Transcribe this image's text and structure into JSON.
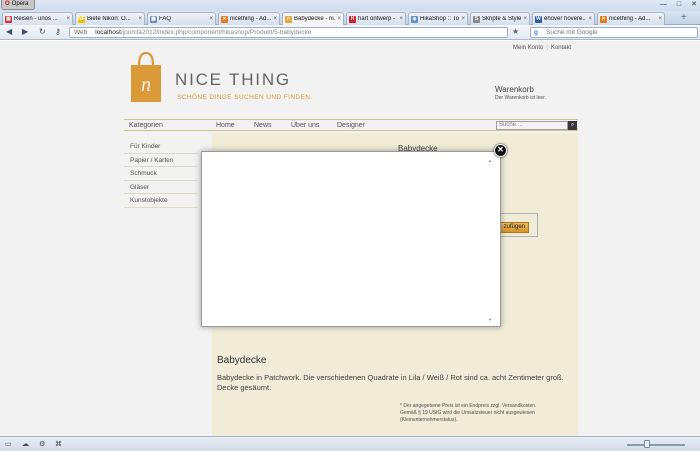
{
  "browser": {
    "app_name": "Opera",
    "window_controls": [
      "—",
      "□",
      "✕"
    ],
    "tabs": [
      {
        "label": "Reisen - unos ...",
        "fav_color": "#cc3333",
        "fav_glyph": "▣"
      },
      {
        "label": "Biete Nikon: O...",
        "fav_color": "#f2c200",
        "fav_glyph": "NF"
      },
      {
        "label": "FAQ",
        "fav_color": "#6b8ab5",
        "fav_glyph": "▦"
      },
      {
        "label": "nicething - Ad...",
        "fav_color": "#e07b1e",
        "fav_glyph": "✕"
      },
      {
        "label": "Babydecke - ni...",
        "fav_color": "#e6a33a",
        "fav_glyph": "n"
      },
      {
        "label": "hart ontwerp - ...",
        "fav_color": "#d0202e",
        "fav_glyph": "H"
      },
      {
        "label": "HikaShop :: To...",
        "fav_color": "#5b8fc4",
        "fav_glyph": "◈"
      },
      {
        "label": "Skripte & Style...",
        "fav_color": "#888888",
        "fav_glyph": "S"
      },
      {
        "label": "ehover hovere...",
        "fav_color": "#2f5aa8",
        "fav_glyph": "W"
      },
      {
        "label": "nicething - Ad...",
        "fav_color": "#e07b1e",
        "fav_glyph": "✕"
      }
    ],
    "tab_close": "×",
    "tab_add": "+",
    "nav": {
      "back": "◀",
      "forward": "▶",
      "reload": "↻",
      "key": "⚷"
    },
    "address": {
      "prefix": "Web",
      "host": "localhost",
      "path": "/joomla2012/index.php/component/hikashop/Produkt/5-babydecke"
    },
    "star": "★",
    "search_placeholder": "Suche mit Google",
    "search_engine_glyph": "g"
  },
  "site": {
    "top_links": [
      "Mein Konto",
      "Kontakt"
    ],
    "logo_title": "NICE THING",
    "logo_subtitle": "SCHÖNE DINGE SUCHEN UND FINDEN.",
    "logo_letter": "n",
    "cart": {
      "title": "Warenkorb",
      "text": "Der Warenkorb ist leer."
    },
    "menu": [
      "Kategorien",
      "Home",
      "News",
      "Über uns",
      "Designer"
    ],
    "search_placeholder": "Suche ...",
    "search_icon_glyph": "⌕",
    "sidebar": [
      "Für Kinder",
      "Papier / Karten",
      "Schmuck",
      "Gläser",
      "Kunstobjekte"
    ],
    "product": {
      "title_top": "Babydecke",
      "cart_button": "zufügen",
      "title": "Babydecke",
      "description": "Babydecke in Patchwork. Die verschiedenen Quadrate in Lila / Weiß / Rot sind ca. acht Zentimeter groß. Decke gesäumt.",
      "note": "* Der angegebene Preis ist ein Endpreis zzgl. Versandkosten. Gemäß § 19 UStG wird die Umsatzsteuer nicht ausgewiesen (Kleinunternehmerstatus)."
    }
  },
  "modal": {
    "close_glyph": "✕",
    "scroll_up": "▲",
    "scroll_down": "▼"
  },
  "statusbar": {
    "icons": [
      "▭",
      "☁",
      "⚙",
      "⌘"
    ]
  }
}
